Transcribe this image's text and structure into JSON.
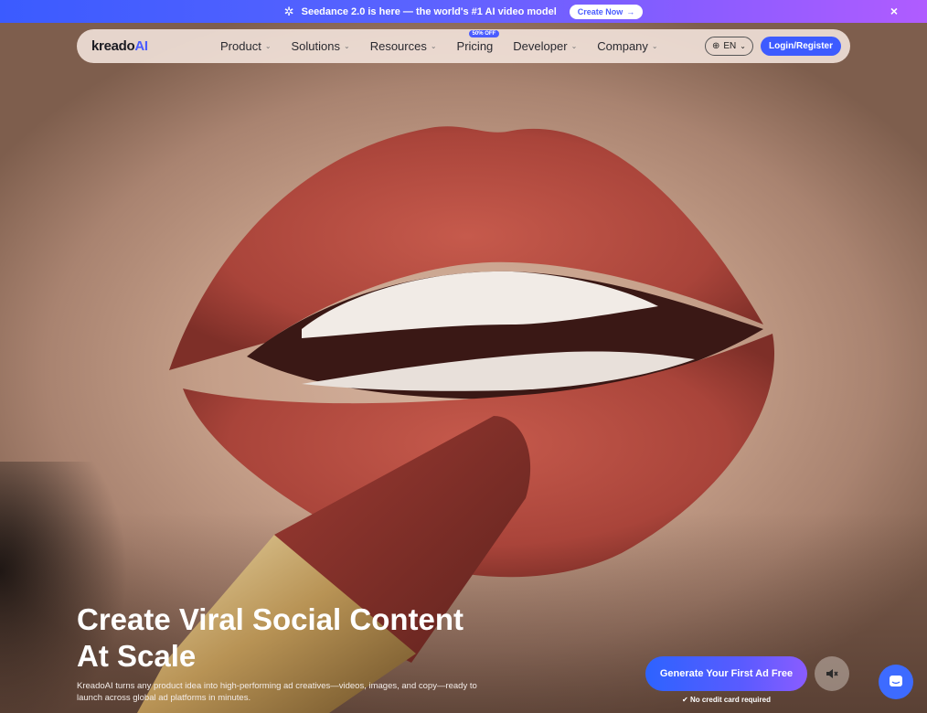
{
  "announcement": {
    "text": "Seedance 2.0 is here — the world's #1 AI video model",
    "cta": "Create Now",
    "close": "×"
  },
  "nav": {
    "logo_main": "kreado",
    "logo_ai": "AI",
    "items": [
      {
        "label": "Product"
      },
      {
        "label": "Solutions"
      },
      {
        "label": "Resources"
      },
      {
        "label": "Pricing",
        "badge": "50% OFF"
      },
      {
        "label": "Developer"
      },
      {
        "label": "Company"
      }
    ],
    "language": "EN",
    "login": "Login/Register"
  },
  "hero": {
    "title_line1": "Create Viral Social Content",
    "title_line2": "At Scale",
    "subtitle": "KreadoAI turns any product idea into high-performing ad creatives—videos, images, and copy—ready to launch across global ad platforms in minutes.",
    "cta": "Generate Your First Ad Free",
    "note": "No credit card required"
  },
  "colors": {
    "accent": "#3d5bff",
    "gradient_end": "#8a5cff"
  },
  "icons": {
    "spark": "sparkle-icon",
    "arrow": "arrow-right-icon",
    "globe": "globe-icon",
    "mute": "speaker-muted-icon",
    "check": "check-circle-icon",
    "chat": "chat-icon"
  }
}
